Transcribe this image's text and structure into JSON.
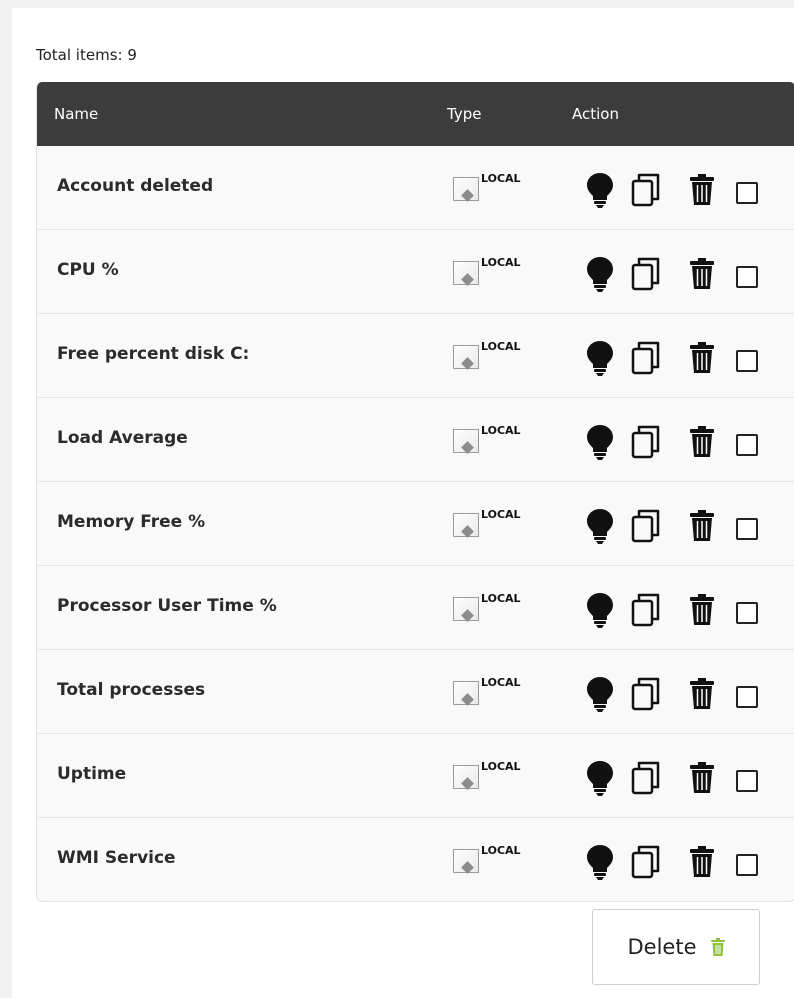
{
  "summary": {
    "total_items": "Total items: 9"
  },
  "table": {
    "columns": {
      "name": "Name",
      "type": "Type",
      "action": "Action"
    },
    "rows": [
      {
        "name": "Account deleted",
        "type": "LOCAL"
      },
      {
        "name": "CPU %",
        "type": "LOCAL"
      },
      {
        "name": "Free percent disk C:",
        "type": "LOCAL"
      },
      {
        "name": "Load Average",
        "type": "LOCAL"
      },
      {
        "name": "Memory Free %",
        "type": "LOCAL"
      },
      {
        "name": "Processor User Time %",
        "type": "LOCAL"
      },
      {
        "name": "Total processes",
        "type": "LOCAL"
      },
      {
        "name": "Uptime",
        "type": "LOCAL"
      },
      {
        "name": "WMI Service",
        "type": "LOCAL"
      }
    ],
    "row_actions": [
      "lightbulb-icon",
      "copy-icon",
      "trash-icon",
      "select-checkbox"
    ]
  },
  "footer": {
    "delete_label": "Delete",
    "delete_icon": "green-trash-icon"
  },
  "colors": {
    "header_bg": "#3c3c3c",
    "row_bg": "#f9f9f9",
    "delete_icon": "#8fc13f"
  }
}
